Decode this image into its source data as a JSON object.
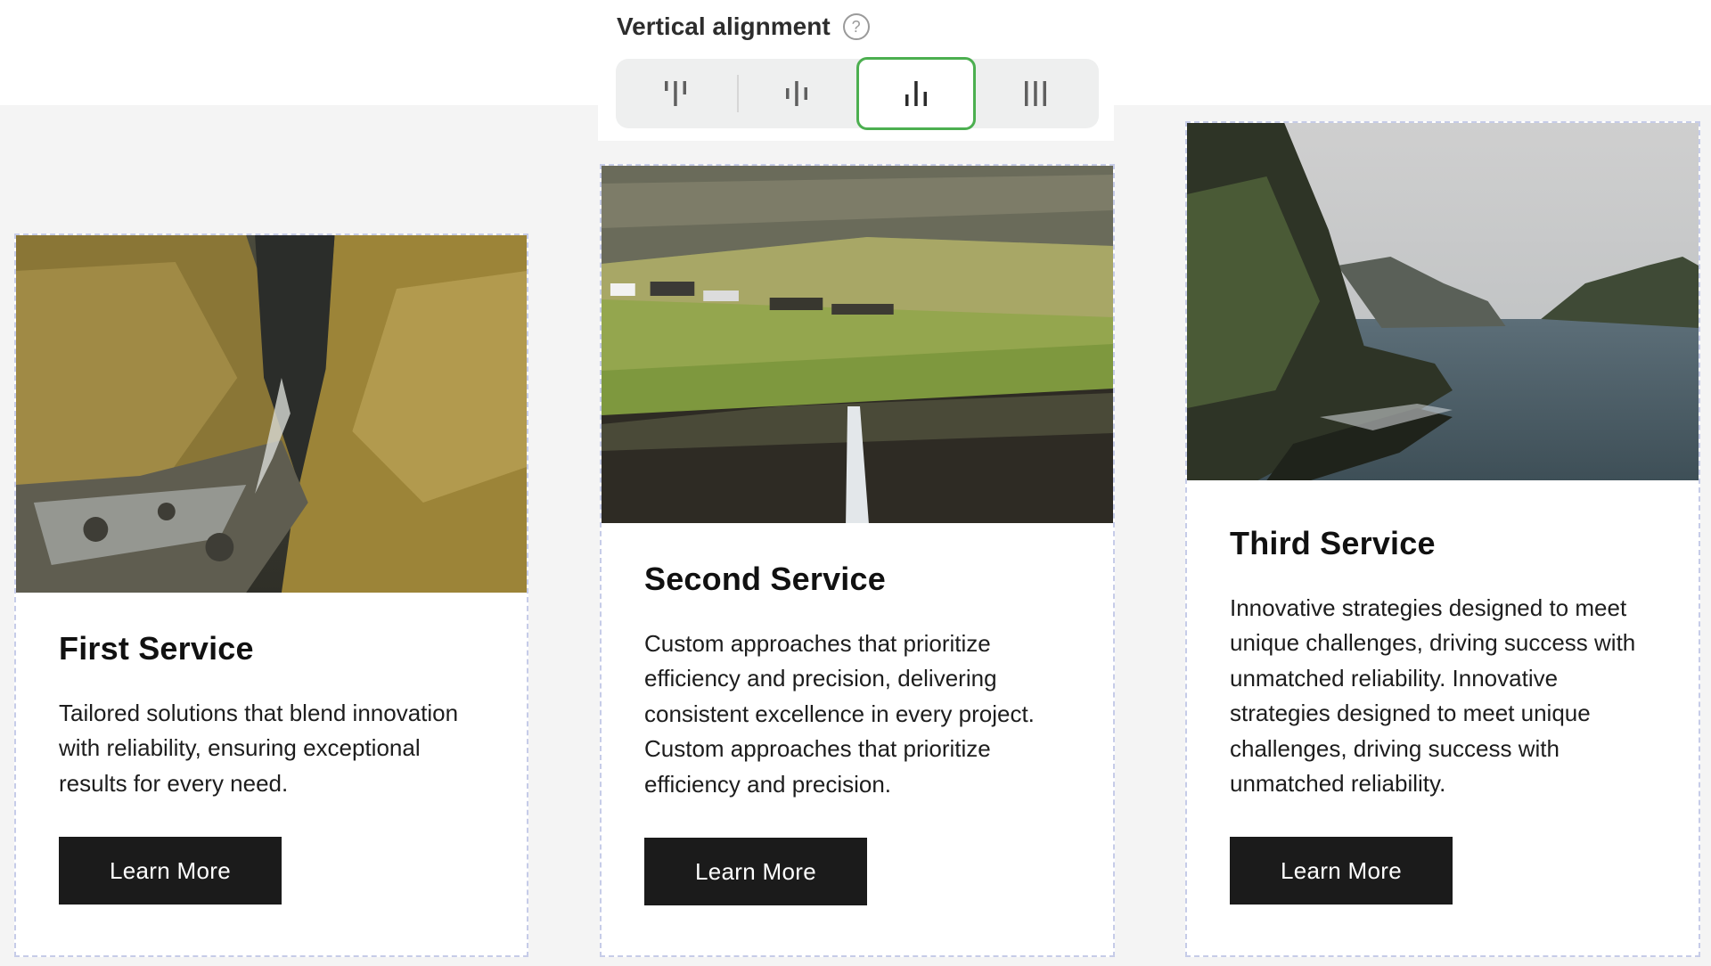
{
  "toolbar": {
    "title": "Vertical alignment",
    "help_icon": "?",
    "options": [
      {
        "name": "align-top",
        "icon": "align-top-icon"
      },
      {
        "name": "align-center",
        "icon": "align-center-icon"
      },
      {
        "name": "align-bottom",
        "icon": "align-bottom-icon",
        "selected": true
      },
      {
        "name": "align-stretch",
        "icon": "align-stretch-icon"
      }
    ],
    "selected_color": "#4caf50"
  },
  "cards": [
    {
      "title": "First Service",
      "text": "Tailored solutions that blend innovation with reliability, ensuring exceptional results for every need.",
      "button": "Learn More",
      "image": "landscape-photo-ravine-stream"
    },
    {
      "title": "Second Service",
      "text": "Custom approaches that prioritize efficiency and precision, delivering consistent excellence in every project. Custom approaches that prioritize efficiency and precision.",
      "button": "Learn More",
      "image": "landscape-photo-village-waterfall"
    },
    {
      "title": "Third Service",
      "text": "Innovative strategies designed to meet unique challenges, driving success with unmatched reliability. Innovative strategies designed to meet unique challenges, driving success with unmatched reliability.",
      "button": "Learn More",
      "image": "landscape-photo-sea-cliffs"
    }
  ],
  "colors": {
    "canvas": "#f4f4f4",
    "button": "#1b1b1b",
    "card_border": "#c6cce8"
  }
}
